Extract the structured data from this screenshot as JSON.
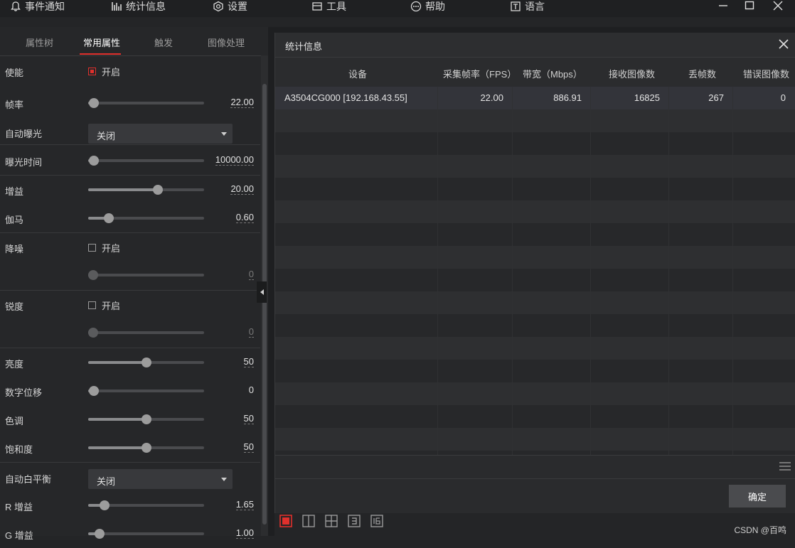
{
  "menu": {
    "items": [
      {
        "label": "事件通知",
        "icon": "bell-icon"
      },
      {
        "label": "统计信息",
        "icon": "bar-chart-icon"
      },
      {
        "label": "设置",
        "icon": "settings-hex-icon"
      },
      {
        "label": "工具",
        "icon": "toolbox-icon"
      },
      {
        "label": "帮助",
        "icon": "help-dots-icon"
      },
      {
        "label": "语言",
        "icon": "language-icon"
      }
    ]
  },
  "left_panel": {
    "tabs": [
      "属性树",
      "常用属性",
      "触发",
      "图像处理"
    ],
    "active_tab": "常用属性",
    "props": {
      "enable": {
        "label": "使能",
        "checkbox_label": "开启",
        "checked": true
      },
      "frame_rate": {
        "label": "帧率",
        "value": "22.00",
        "level": 0.05
      },
      "auto_exposure": {
        "label": "自动曝光",
        "value": "关闭"
      },
      "exposure_time": {
        "label": "曝光时间",
        "value": "10000.00",
        "level": 0.05
      },
      "gain": {
        "label": "增益",
        "value": "20.00",
        "level": 0.6
      },
      "gamma": {
        "label": "伽马",
        "value": "0.60",
        "level": 0.18
      },
      "denoise": {
        "label": "降噪",
        "checkbox_label": "开启",
        "checked": false,
        "value": "0",
        "level": 0.04
      },
      "sharpness": {
        "label": "锐度",
        "checkbox_label": "开启",
        "checked": false,
        "value": "0",
        "level": 0.04
      },
      "brightness": {
        "label": "亮度",
        "value": "50",
        "level": 0.5
      },
      "digital_shift": {
        "label": "数字位移",
        "value": "0",
        "level": 0.05
      },
      "hue": {
        "label": "色调",
        "value": "50",
        "level": 0.5
      },
      "saturation": {
        "label": "饱和度",
        "value": "50",
        "level": 0.5
      },
      "auto_wb": {
        "label": "自动白平衡",
        "value": "关闭"
      },
      "r_gain": {
        "label": "R 增益",
        "value": "1.65",
        "level": 0.14
      },
      "g_gain": {
        "label": "G 增益",
        "value": "1.00",
        "level": 0.1
      }
    }
  },
  "dialog": {
    "title": "统计信息",
    "columns": [
      "设备",
      "采集帧率（FPS）",
      "带宽（Mbps）",
      "接收图像数",
      "丢帧数",
      "错误图像数"
    ],
    "rows": [
      [
        "A3504CG000 [192.168.43.55]",
        "22.00",
        "886.91",
        "16825",
        "267",
        "0"
      ]
    ],
    "confirm_label": "确定"
  },
  "watermark": "CSDN @百鸣",
  "colors": {
    "accent": "#e0302c",
    "panel": "#262729",
    "dialog": "#2a2b2d"
  }
}
